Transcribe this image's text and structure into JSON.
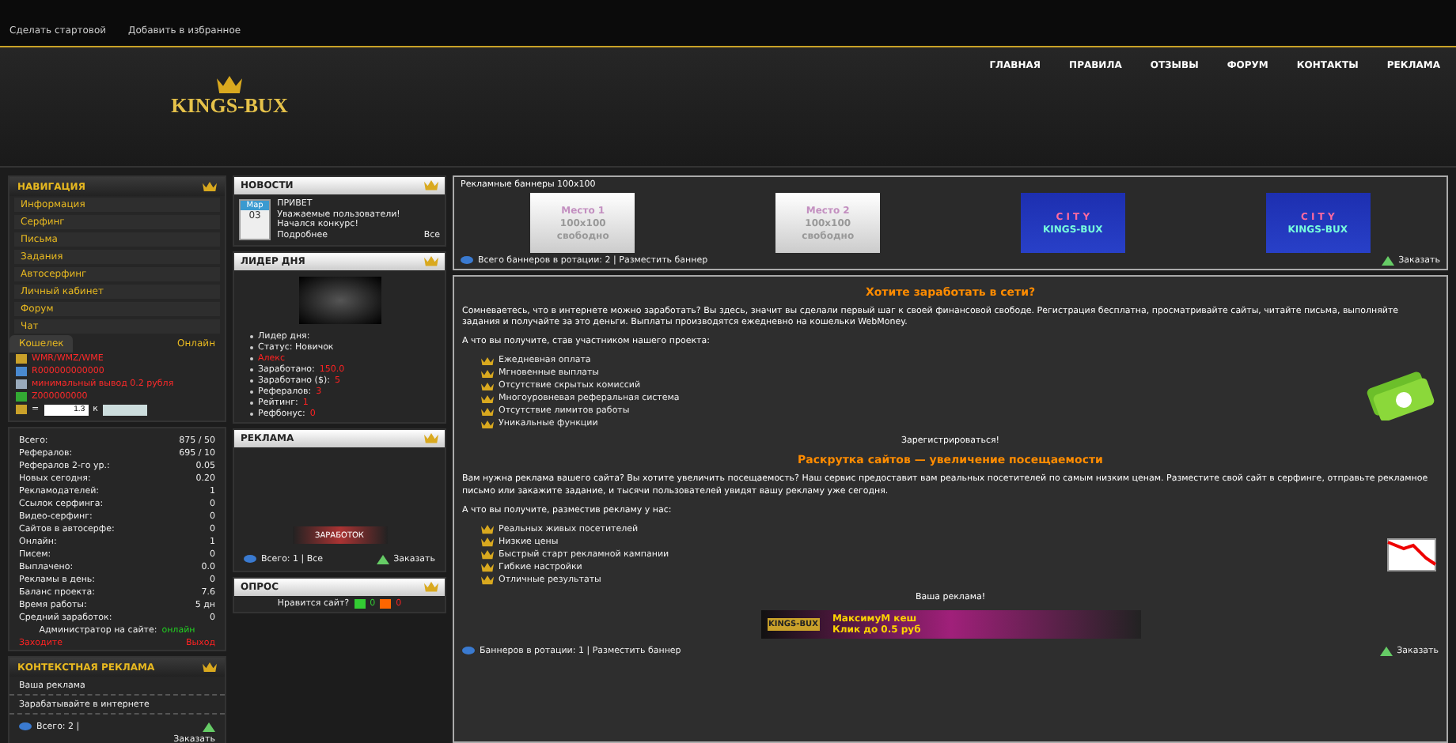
{
  "topbar": {
    "links": [
      "Сделать стартовой",
      "Добавить в избранное"
    ]
  },
  "logo": {
    "text": "KINGS-BUX"
  },
  "nav": [
    "ГЛАВНАЯ",
    "ПРАВИЛА",
    "ОТЗЫВЫ",
    "ФОРУМ",
    "КОНТАКТЫ",
    "РЕКЛАМА"
  ],
  "navigation": {
    "title": "НАВИГАЦИЯ",
    "items": [
      "Информация",
      "Серфинг",
      "Письма",
      "Задания",
      "Автосерфинг",
      "Личный кабинет",
      "Форум",
      "Чат"
    ]
  },
  "wallet": {
    "tabs": [
      {
        "label": "Кошелек",
        "selected": true
      },
      {
        "label": "Онлайн",
        "selected": false
      }
    ],
    "rows": [
      "WMR/WMZ/WME",
      "R000000000000",
      "минимальный вывод 0.2 рубля",
      "Z000000000"
    ],
    "rate_label": "=",
    "rate_value": "1.3",
    "rate_suffix": "к"
  },
  "stats": [
    {
      "label": "Всего:",
      "value": "875 / 50"
    },
    {
      "label": "Рефералов:",
      "value": "695 / 10"
    },
    {
      "label": "Рефералов 2-го ур.:",
      "value": "0.05"
    },
    {
      "label": "Новых сегодня:",
      "value": "0.20"
    },
    {
      "label": "Рекламодателей:",
      "value": "1"
    },
    {
      "label": "Ссылок серфинга:",
      "value": "0"
    },
    {
      "label": "Видео-серфинг:",
      "value": "0"
    },
    {
      "label": "Сайтов в автосерфе:",
      "value": "0"
    },
    {
      "label": "Онлайн:",
      "value": "1"
    },
    {
      "label": "Писем:",
      "value": "0"
    },
    {
      "label": "Выплачено:",
      "value": "0.0"
    },
    {
      "label": "Рекламы в день:",
      "value": "0"
    },
    {
      "label": "Баланс проекта:",
      "value": "7.6"
    },
    {
      "label": "Время работы:",
      "value": "5 дн"
    },
    {
      "label": "Средний заработок:",
      "value": "0"
    }
  ],
  "stats_online": {
    "label": "Администратор на сайте:",
    "status": "онлайн",
    "left": "Заходите",
    "right": "Выход"
  },
  "context_ads": {
    "title": "КОНТЕКСТНАЯ РЕКЛАМА",
    "items": [
      "Ваша реклама",
      "Зарабатывайте в интернете"
    ],
    "link": "Всего: 2 | ",
    "order": "Заказать"
  },
  "news": {
    "title": "НОВОСТИ",
    "month": "Мар",
    "day": "03",
    "heading": "ПРИВЕТ",
    "text": "Уважаемые пользователи! Начался конкурс!",
    "more": "Подробнее",
    "extra": "Все"
  },
  "leader": {
    "title": "ЛИДЕР ДНЯ",
    "items": [
      {
        "label": "Лидер дня:"
      },
      {
        "label": "Статус: Новичок"
      },
      {
        "value": "Алекс"
      },
      {
        "label": "Заработано:",
        "value": "150.0"
      },
      {
        "label": "Заработано ($):",
        "value": "5"
      },
      {
        "label": "Рефералов:",
        "value": "3"
      },
      {
        "label": "Рейтинг:",
        "value": "1"
      },
      {
        "label": "Рефбонус:",
        "value": "0"
      }
    ]
  },
  "banners_side": {
    "title": "РЕКЛАМА",
    "banner": "ЗАРАБОТОК",
    "links": "Всего: 1 | Все",
    "order": "Заказать"
  },
  "poll": {
    "title": "ОПРОС",
    "text": "Нравится сайт?",
    "yes": "0",
    "no": "0"
  },
  "banners_top": {
    "legend": "Рекламные баннеры 100x100",
    "items": [
      {
        "kind": "light",
        "line1": "Место 1",
        "line2": "100x100",
        "line3": "свободно"
      },
      {
        "kind": "light",
        "line1": "Место 2",
        "line2": "100x100",
        "line3": "свободно"
      },
      {
        "kind": "blue",
        "line1": "C I T Y",
        "line2": "KINGS-BUX"
      },
      {
        "kind": "blue",
        "line1": "C I T Y",
        "line2": "KINGS-BUX"
      }
    ],
    "footer": "Всего баннеров в ротации: 2 | Разместить баннер",
    "order": "Заказать"
  },
  "sections": [
    {
      "title": "Хотите заработать в сети?",
      "text": "Сомневаетесь, что в интернете можно заработать? Вы здесь, значит вы сделали первый шаг к своей финансовой свободе. Регистрация бесплатна, просматривайте сайты, читайте письма, выполняйте задания и получайте за это деньги. Выплаты производятся ежедневно на кошельки WebMoney.",
      "lead": "А что вы получите, став участником нашего проекта:",
      "items": [
        "Ежедневная оплата",
        "Мгновенные выплаты",
        "Отсутствие скрытых комиссий",
        "Многоуровневая реферальная система",
        "Отсутствие лимитов работы",
        "Уникальные функции"
      ],
      "kind": "money",
      "cta": "Зарегистрироваться!"
    },
    {
      "title": "Раскрутка сайтов — увеличение посещаемости",
      "text": "Вам нужна реклама вашего сайта? Вы хотите увеличить посещаемость? Наш сервис предоставит вам реальных посетителей по самым низким ценам. Разместите свой сайт в серфинге, отправьте рекламное письмо или закажите задание, и тысячи пользователей увидят вашу рекламу уже сегодня.",
      "lead": "А что вы получите, разместив рекламу у нас:",
      "items": [
        "Реальных живых посетителей",
        "Низкие цены",
        "Быстрый старт рекламной кампании",
        "Гибкие настройки",
        "Отличные результаты"
      ],
      "kind": "chart",
      "cta": "Ваша реклама!"
    }
  ],
  "ad_banner": {
    "brand": "KINGS-BUX",
    "line1": "МаксимуМ кеш",
    "line2": "Клик до 0.5 руб"
  },
  "footer": {
    "links": "Баннеров в ротации: 1 | Разместить баннер",
    "order": "Заказать"
  }
}
